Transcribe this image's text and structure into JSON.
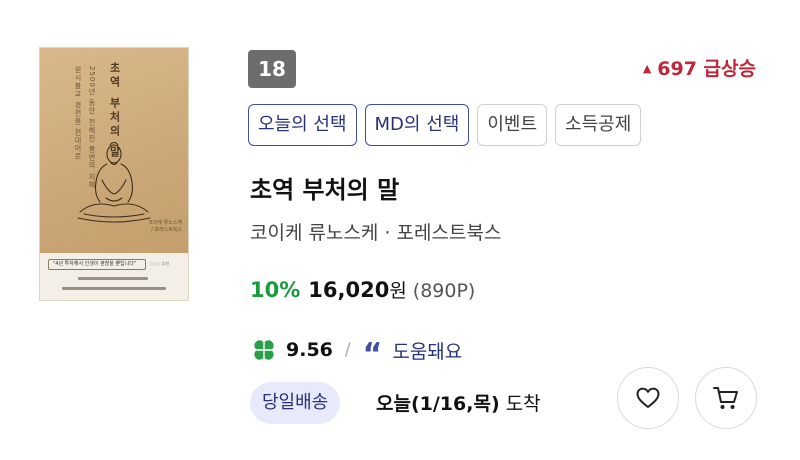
{
  "book": {
    "cover": {
      "image_alt": "초역 부처의 말 book cover",
      "title_vertical": "초역 부처의 말",
      "subtitle_vertical_1": "2500년 동안 전해진 불변의 지혜",
      "subtitle_vertical_2": "원시불교 경전을 현대어로",
      "side_note": "코이케 류노스케 / 포레스트북스",
      "quote": "\"4년 투자해서 인생이 괜찮을 뿐입니다\"",
      "quote_source": "○○○ 추천"
    },
    "rank": "18",
    "trend": {
      "arrow": "▲",
      "text": "697 급상승",
      "color": "#c0263a"
    },
    "tags": [
      {
        "label": "오늘의 선택",
        "style": "primary"
      },
      {
        "label": "MD의 선택",
        "style": "primary"
      },
      {
        "label": "이벤트",
        "style": "plain"
      },
      {
        "label": "소득공제",
        "style": "plain"
      }
    ],
    "title": "초역 부처의 말",
    "author_publisher": "코이케 류노스케 · 포레스트북스",
    "price": {
      "discount": "10%",
      "amount": "16,020",
      "currency": "원",
      "points": "(890P)",
      "discount_color": "#1b9a3c"
    },
    "rating": {
      "icon": "clover-icon",
      "score": "9.56",
      "separator": "/",
      "review_icon": "quote-icon",
      "review_glyph": "“",
      "review_label": "도움돼요",
      "accent": "#3d4fa3"
    },
    "shipping": {
      "badge": "당일배송",
      "arrival_date": "오늘(1/16,목)",
      "arrival_suffix": "도착"
    },
    "actions": {
      "like_icon": "heart-icon",
      "cart_icon": "cart-icon"
    }
  }
}
